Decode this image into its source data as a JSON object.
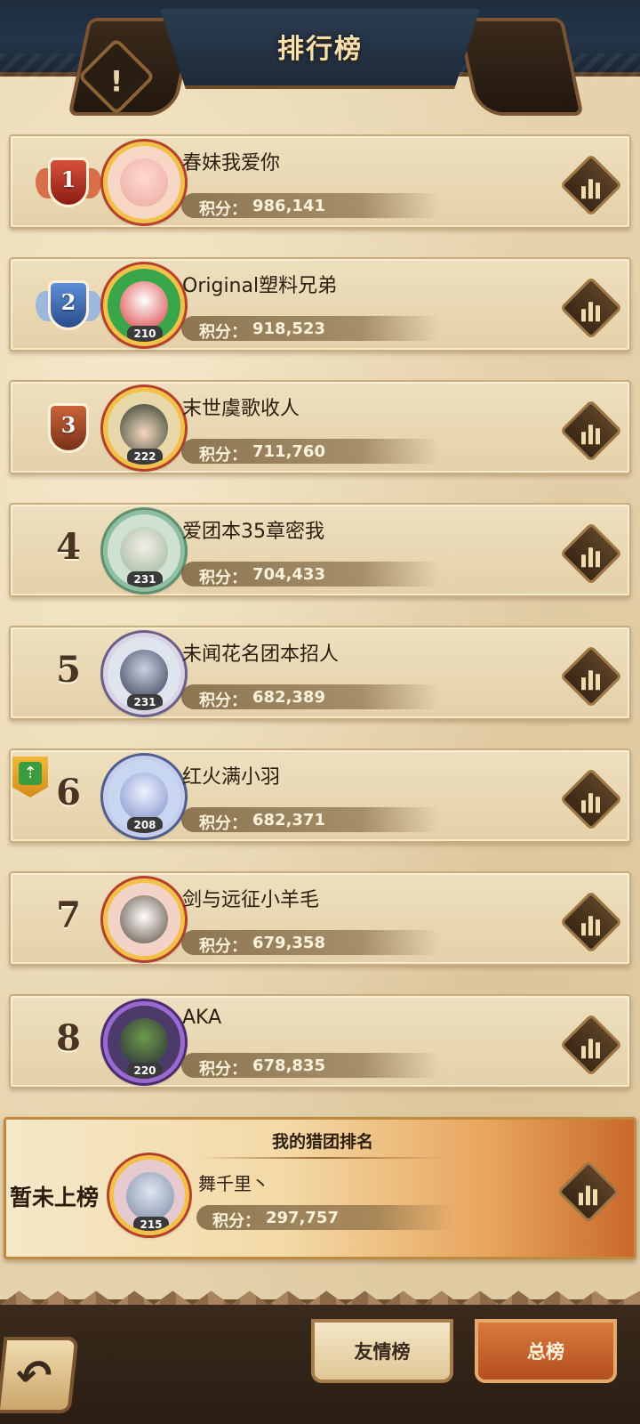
{
  "header": {
    "title": "排行榜"
  },
  "icons": {
    "info": "exclamation-icon",
    "stats": "bar-chart-icon",
    "back": "back-arrow-icon",
    "rank_up": "rank-up-icon"
  },
  "leaderboard": {
    "score_label": "积分：",
    "rows": [
      {
        "rank": "1",
        "name": "春妹我爱你",
        "score": "986,141",
        "level": ""
      },
      {
        "rank": "2",
        "name": "Original塑料兄弟",
        "score": "918,523",
        "level": "210"
      },
      {
        "rank": "3",
        "name": "末世虞歌收人",
        "score": "711,760",
        "level": "222"
      },
      {
        "rank": "4",
        "name": "爱团本35章密我",
        "score": "704,433",
        "level": "231"
      },
      {
        "rank": "5",
        "name": "未闻花名团本招人",
        "score": "682,389",
        "level": "231"
      },
      {
        "rank": "6",
        "name": "红火满小羽",
        "score": "682,371",
        "level": "208"
      },
      {
        "rank": "7",
        "name": "剑与远征小羊毛",
        "score": "679,358",
        "level": ""
      },
      {
        "rank": "8",
        "name": "AKA",
        "score": "678,835",
        "level": "220"
      }
    ]
  },
  "my_rank": {
    "title": "我的猎团排名",
    "status": "暂未上榜",
    "name": "舞千里丶",
    "score_label": "积分：",
    "score": "297,757",
    "level": "215"
  },
  "bottom_nav": {
    "friends_tab": "友情榜",
    "total_tab": "总榜"
  },
  "colors": {
    "panel": "#e5d1a8",
    "accent_orange": "#c9692c",
    "header_navy": "#1e2c3e"
  }
}
